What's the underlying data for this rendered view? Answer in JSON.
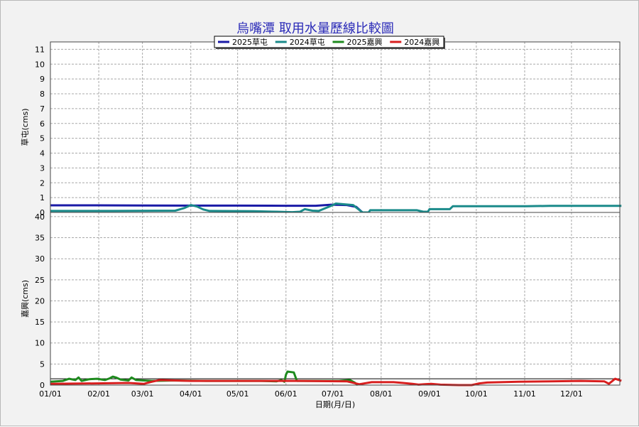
{
  "chart_data": {
    "type": "line",
    "title": "烏嘴潭 取用水量歷線比較圖",
    "xlabel": "日期(月/日)",
    "x_ticks": [
      "01/01",
      "02/01",
      "03/01",
      "04/01",
      "05/01",
      "06/01",
      "07/01",
      "08/01",
      "09/01",
      "10/01",
      "11/01",
      "12/01"
    ],
    "x_tick_days": [
      0,
      31,
      59,
      90,
      120,
      151,
      181,
      212,
      243,
      273,
      304,
      334
    ],
    "xlim": [
      0,
      365
    ],
    "legend": {
      "placement": "top-center",
      "entries": [
        {
          "name": "2025草屯",
          "color": "#1a1aa6"
        },
        {
          "name": "2024草屯",
          "color": "#1a8a8a"
        },
        {
          "name": "2025嘉興",
          "color": "#1e8a1e"
        },
        {
          "name": "2024嘉興",
          "color": "#d81e1e"
        }
      ]
    },
    "panels": [
      {
        "id": "top",
        "ylabel": "草屯(cms)",
        "ylim": [
          0,
          11.5
        ],
        "y_ticks": [
          0,
          1,
          2,
          3,
          4,
          5,
          6,
          7,
          8,
          9,
          10,
          11
        ],
        "series": [
          {
            "name": "2025草屯",
            "color": "#1a1aa6",
            "points": [
              [
                0,
                0.48
              ],
              [
                30,
                0.48
              ],
              [
                60,
                0.47
              ],
              [
                90,
                0.46
              ],
              [
                120,
                0.46
              ],
              [
                150,
                0.45
              ],
              [
                170,
                0.45
              ],
              [
                180,
                0.52
              ],
              [
                190,
                0.5
              ],
              [
                196,
                0.38
              ],
              [
                200,
                0
              ]
            ]
          },
          {
            "name": "2024草屯",
            "color": "#1a8a8a",
            "points": [
              [
                0,
                0.1
              ],
              [
                40,
                0.1
              ],
              [
                80,
                0.12
              ],
              [
                86,
                0.3
              ],
              [
                90,
                0.5
              ],
              [
                94,
                0.4
              ],
              [
                98,
                0.2
              ],
              [
                102,
                0.1
              ],
              [
                130,
                0.08
              ],
              [
                145,
                0.05
              ],
              [
                155,
                0.02
              ],
              [
                160,
                0.05
              ],
              [
                163,
                0.22
              ],
              [
                168,
                0.12
              ],
              [
                172,
                0.1
              ],
              [
                176,
                0.28
              ],
              [
                180,
                0.45
              ],
              [
                183,
                0.6
              ],
              [
                188,
                0.55
              ],
              [
                194,
                0.5
              ],
              [
                197,
                0.25
              ],
              [
                200,
                0
              ],
              [
                204,
                0
              ],
              [
                205,
                0.15
              ],
              [
                230,
                0.15
              ],
              [
                235,
                0.15
              ],
              [
                239,
                0.05
              ],
              [
                242,
                0.05
              ],
              [
                243,
                0.22
              ],
              [
                256,
                0.22
              ],
              [
                258,
                0.42
              ],
              [
                290,
                0.42
              ],
              [
                305,
                0.42
              ],
              [
                320,
                0.44
              ],
              [
                366,
                0.44
              ]
            ]
          }
        ]
      },
      {
        "id": "bottom",
        "ylabel": "嘉興(cms)",
        "ylim": [
          0,
          41
        ],
        "y_ticks": [
          0,
          5,
          10,
          15,
          20,
          25,
          30,
          35,
          40
        ],
        "reference_line": 1.5,
        "series": [
          {
            "name": "2025嘉興",
            "color": "#1e8a1e",
            "points": [
              [
                0,
                0.8
              ],
              [
                8,
                1
              ],
              [
                12,
                1.5
              ],
              [
                16,
                1.2
              ],
              [
                18,
                1.8
              ],
              [
                20,
                1
              ],
              [
                25,
                1.4
              ],
              [
                30,
                1.5
              ],
              [
                35,
                1.2
              ],
              [
                38,
                1.6
              ],
              [
                40,
                2
              ],
              [
                42,
                1.8
              ],
              [
                45,
                1.3
              ],
              [
                50,
                1.1
              ],
              [
                52,
                1.8
              ],
              [
                55,
                1.2
              ],
              [
                65,
                1
              ],
              [
                80,
                1.1
              ],
              [
                100,
                1
              ],
              [
                120,
                1
              ],
              [
                135,
                1
              ],
              [
                145,
                0.9
              ],
              [
                148,
                1.2
              ],
              [
                150,
                0.8
              ],
              [
                151,
                2.5
              ],
              [
                152,
                3.2
              ],
              [
                156,
                3.0
              ],
              [
                157,
                2.0
              ],
              [
                158,
                1.0
              ],
              [
                170,
                1
              ],
              [
                185,
                1
              ],
              [
                192,
                1.2
              ],
              [
                195,
                0.6
              ],
              [
                197,
                0
              ]
            ]
          },
          {
            "name": "2024嘉興",
            "color": "#d81e1e",
            "points": [
              [
                0,
                0.3
              ],
              [
                30,
                0.4
              ],
              [
                50,
                0.5
              ],
              [
                60,
                0.3
              ],
              [
                65,
                0.8
              ],
              [
                70,
                1.2
              ],
              [
                90,
                1.0
              ],
              [
                110,
                1.0
              ],
              [
                160,
                1.0
              ],
              [
                190,
                0.9
              ],
              [
                198,
                0.2
              ],
              [
                206,
                0.7
              ],
              [
                220,
                0.7
              ],
              [
                226,
                0.5
              ],
              [
                232,
                0.3
              ],
              [
                236,
                0.1
              ],
              [
                240,
                0.2
              ],
              [
                244,
                0.3
              ],
              [
                250,
                0.1
              ],
              [
                262,
                0
              ],
              [
                270,
                0
              ],
              [
                275,
                0.4
              ],
              [
                280,
                0.6
              ],
              [
                300,
                0.8
              ],
              [
                320,
                0.9
              ],
              [
                340,
                1.0
              ],
              [
                355,
                0.9
              ],
              [
                358,
                0.3
              ],
              [
                362,
                1.5
              ],
              [
                366,
                1.0
              ]
            ]
          }
        ]
      }
    ]
  }
}
